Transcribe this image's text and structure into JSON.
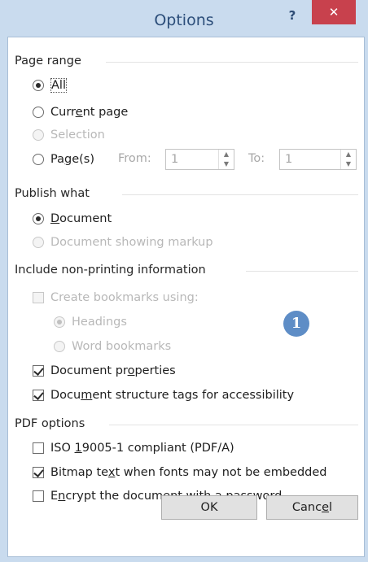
{
  "window": {
    "title": "Options",
    "help_label": "?",
    "close_label": "✕"
  },
  "page_range": {
    "heading": "Page range",
    "all_label": "All",
    "current_page_pre": "Curr",
    "current_page_u": "e",
    "current_page_post": "nt page",
    "selection_label": "Selection",
    "pages_pre": "Pa",
    "pages_u": "g",
    "pages_post": "e(s)",
    "from_label": "From:",
    "from_value": "1",
    "to_label": "To:",
    "to_value": "1",
    "selected": "All"
  },
  "publish_what": {
    "heading": "Publish what",
    "document_u": "D",
    "document_post": "ocument",
    "markup_label": "Document showing markup",
    "selected": "Document"
  },
  "non_printing": {
    "heading": "Include non-printing information",
    "bookmarks_label": "Create bookmarks using:",
    "headings_label": "Headings",
    "word_bookmarks_label": "Word bookmarks",
    "properties_pre": "Document pr",
    "properties_u": "o",
    "properties_post": "perties",
    "structure_pre": "Docu",
    "structure_u": "m",
    "structure_post": "ent structure tags for accessibility",
    "bookmarks_checked": false,
    "properties_checked": true,
    "structure_checked": true
  },
  "pdf_options": {
    "heading": "PDF options",
    "iso_pre": "ISO ",
    "iso_u": "1",
    "iso_post": "9005-1 compliant (PDF/A)",
    "bitmap_pre": "Bitmap te",
    "bitmap_u": "x",
    "bitmap_post": "t when fonts may not be embedded",
    "encrypt_pre": "E",
    "encrypt_u": "n",
    "encrypt_post": "crypt the document with a password",
    "iso_checked": false,
    "bitmap_checked": true,
    "encrypt_checked": false
  },
  "callout": {
    "label": "1"
  },
  "buttons": {
    "ok_label": "OK",
    "cancel_pre": "Canc",
    "cancel_u": "e",
    "cancel_post": "l"
  },
  "colors": {
    "title_bar": "#c9dbee",
    "close_button": "#c8414d",
    "badge": "#5e8dc6"
  }
}
